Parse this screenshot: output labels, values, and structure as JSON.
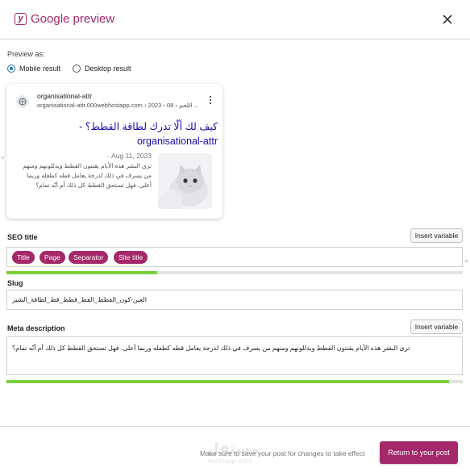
{
  "modal": {
    "title": "Google preview",
    "logo_icon": "yoast-logo-icon",
    "close_icon": "close-icon"
  },
  "preview_as": {
    "label": "Preview as:",
    "options": [
      {
        "label": "Mobile result",
        "selected": true
      },
      {
        "label": "Desktop result",
        "selected": false
      }
    ]
  },
  "serp": {
    "site_name": "organisational-attr",
    "url": "organisational-attr.000webhostapp.com › 2023 › 08 › اللحم…",
    "title": "كيف لك ألّا تدرك لطاقة القطط؟ - organisational-attr",
    "date": "Aug 11, 2023",
    "date_separator": "-",
    "description": "ترى البشر هذه الأيام يقتنون القطط ويدللونهم ومنهم من يسرف في ذلك لدرجة يعامل قطه كطفله وربما أعلى. فهل تستحق القطط كل ذلك أم أنّه تمام؟",
    "thumbnail_icon": "cat-thumbnail-image",
    "menu_icon": "kebab-menu-icon"
  },
  "seo_title": {
    "label": "SEO title",
    "insert_variable": "Insert variable",
    "chips": [
      "Title",
      "Page",
      "Separator",
      "Site title"
    ],
    "progress": 0.33,
    "progress_color": "#7ad03a"
  },
  "slug": {
    "label": "Slug",
    "value": "العين-كون_القطط_القط_قطط_قط_لطاقة_الشير"
  },
  "meta_description": {
    "label": "Meta description",
    "insert_variable": "Insert variable",
    "value": "ترى البشر هذه الأيام يقتنون القطط ويدللونهم ومنهم من يسرف في ذلك لدرجة يعامل قطه كطفله وربما أعلى. فهل تستحق القطط كل ذلك أم أنّه تمام؟",
    "progress": 0.97,
    "progress_color": "#7ad03a"
  },
  "footer": {
    "note": "Make sure to save your post for changes to take effect",
    "watermark": "مستقل",
    "watermark_sub": "mostaql.com",
    "return_button": "Return to your post"
  },
  "colors": {
    "brand": "#a4286a",
    "link": "#1a0dab",
    "radio": "#2271b1"
  }
}
